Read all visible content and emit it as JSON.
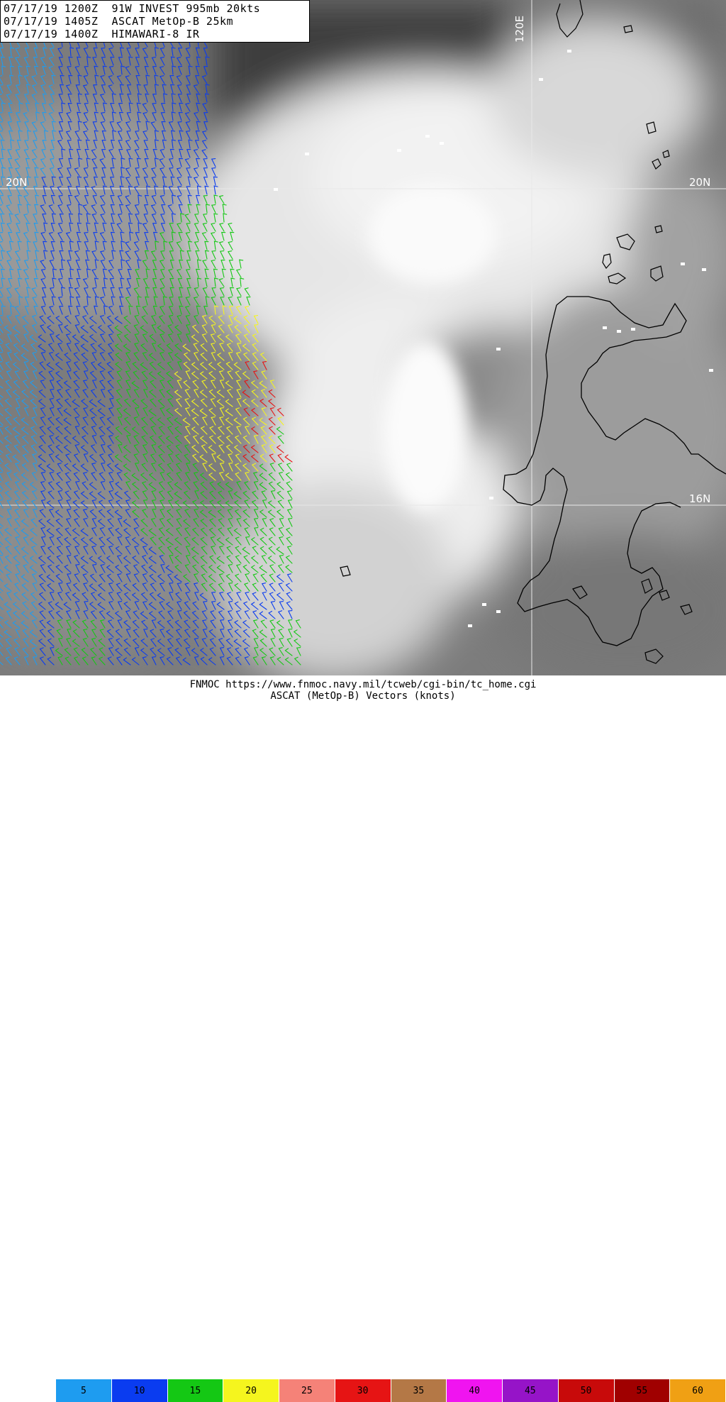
{
  "header": {
    "line1": "07/17/19 1200Z  91W INVEST 995mb 20kts",
    "line2": "07/17/19 1405Z  ASCAT MetOp-B 25km",
    "line3": "07/17/19 1400Z  HIMAWARI-8 IR"
  },
  "grid_labels": {
    "lon_120e": "120E",
    "lat_20n_left": "20N",
    "lat_20n": "20N",
    "lat_16n": "16N"
  },
  "footer": {
    "url_line": "FNMOC https://www.fnmoc.navy.mil/tcweb/cgi-bin/tc_home.cgi",
    "legend_title": "ASCAT (MetOp-B) Vectors (knots)"
  },
  "legend": [
    {
      "label": "5",
      "color": "#1e9cf0"
    },
    {
      "label": "10",
      "color": "#0a3cf0"
    },
    {
      "label": "15",
      "color": "#14c814"
    },
    {
      "label": "20",
      "color": "#f5f51e"
    },
    {
      "label": "25",
      "color": "#f58278"
    },
    {
      "label": "30",
      "color": "#e61414"
    },
    {
      "label": "35",
      "color": "#b47846"
    },
    {
      "label": "40",
      "color": "#f014f0"
    },
    {
      "label": "45",
      "color": "#9614c8"
    },
    {
      "label": "50",
      "color": "#c80a0a"
    },
    {
      "label": "55",
      "color": "#a00000"
    },
    {
      "label": "60",
      "color": "#f0a014"
    }
  ]
}
